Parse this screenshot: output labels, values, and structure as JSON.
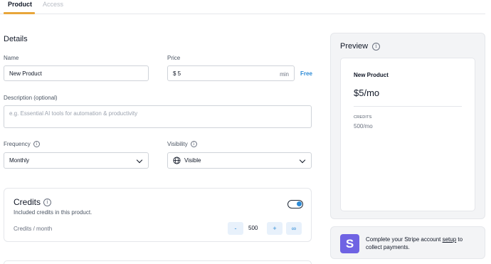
{
  "tabs": [
    {
      "label": "Product",
      "active": true
    },
    {
      "label": "Access",
      "active": false
    }
  ],
  "details": {
    "title": "Details",
    "name": {
      "label": "Name",
      "value": "New Product"
    },
    "price": {
      "label": "Price",
      "value": "$ 5",
      "suffix": "min",
      "free_link": "Free"
    },
    "description": {
      "label": "Description (optional)",
      "placeholder": "e.g. Essential AI tools for automation & productivity"
    },
    "frequency": {
      "label": "Frequency",
      "value": "Monthly"
    },
    "visibility": {
      "label": "Visibility",
      "value": "Visible"
    }
  },
  "credits": {
    "title": "Credits",
    "subtitle": "Included credits in this product.",
    "row_label": "Credits / month",
    "enabled": true,
    "decrement": "-",
    "value": "500",
    "increment": "+",
    "infinite": "∞"
  },
  "preview": {
    "title": "Preview",
    "product_name": "New Product",
    "price": "$5/mo",
    "credits_label": "CREDITS",
    "credits_value": "500/mo"
  },
  "stripe": {
    "logo": "S",
    "text_before": "Complete your Stripe account ",
    "link": "setup",
    "text_after": " to collect payments."
  },
  "colors": {
    "accent": "#e8a63a",
    "link": "#2b8ad6",
    "stripe": "#6f63e3"
  }
}
